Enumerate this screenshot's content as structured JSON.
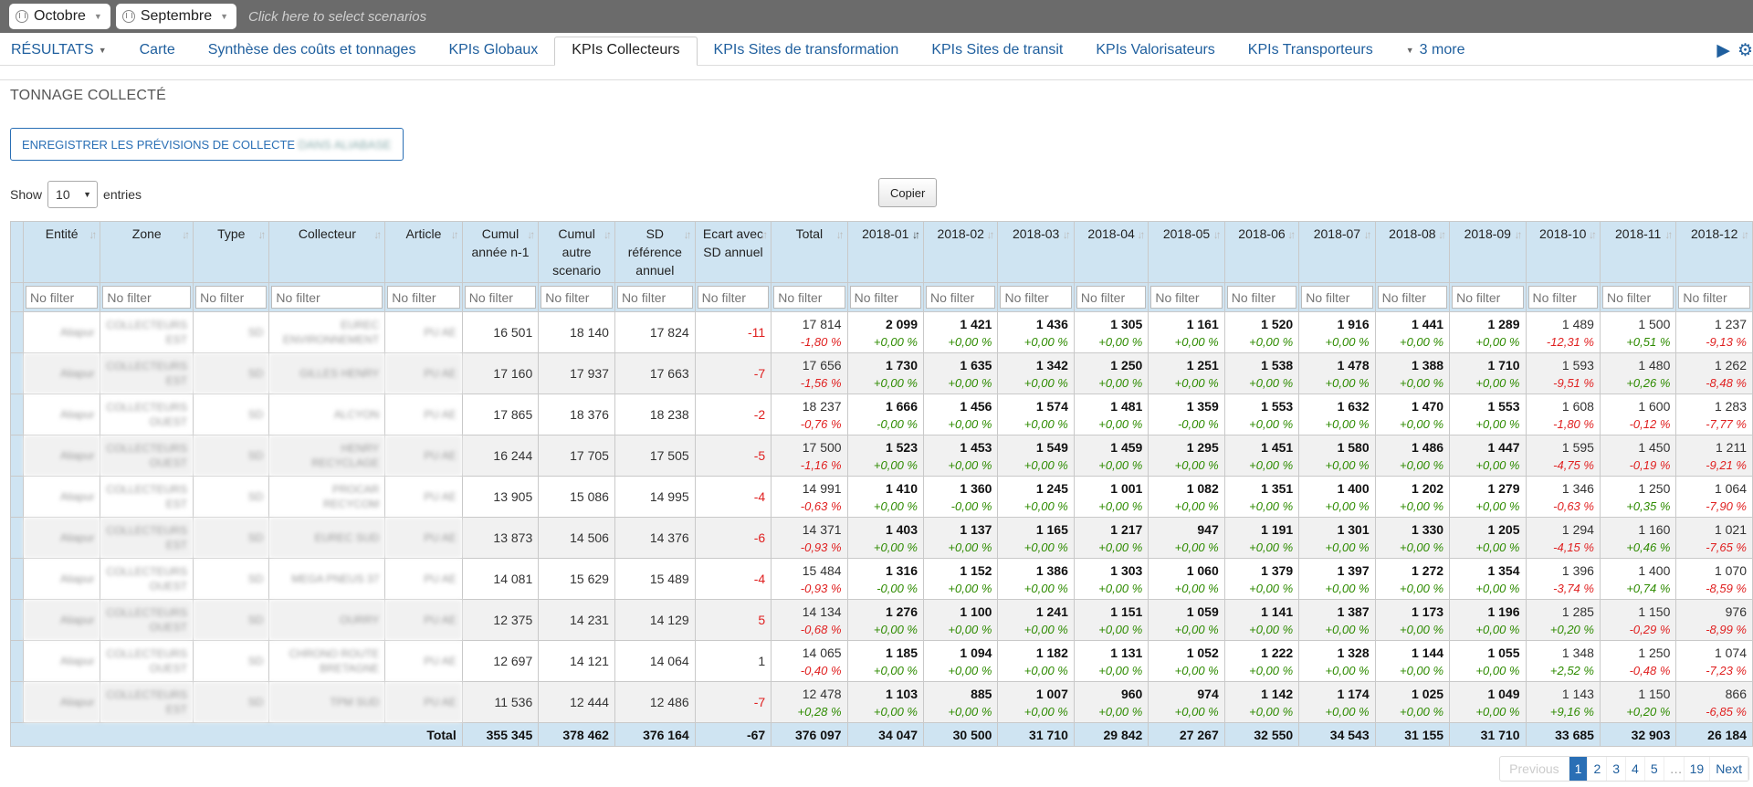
{
  "scenarios": {
    "first": "Octobre",
    "second": "Septembre",
    "placeholder": "Click here to select scenarios"
  },
  "nav": {
    "results": "RÉSULTATS",
    "tabs": [
      "Carte",
      "Synthèse des coûts et tonnages",
      "KPIs Globaux",
      "KPIs Collecteurs",
      "KPIs Sites de transformation",
      "KPIs Sites de transit",
      "KPIs Valorisateurs",
      "KPIs Transporteurs"
    ],
    "active": "KPIs Collecteurs",
    "more": "3 more"
  },
  "section_title": "TONNAGE COLLECTÉ",
  "save_button": {
    "text": "ENREGISTRER LES PRÉVISIONS DE COLLECTE",
    "blurred": "DANS ALIABASE"
  },
  "copy_button": "Copier",
  "length": {
    "show": "Show",
    "value": "10",
    "entries": "entries"
  },
  "filter_placeholder": "No filter",
  "colors": {
    "header_bg": "#cfe4f2",
    "link": "#1f5f9e",
    "positive": "#2e8b00",
    "negative": "#e02020",
    "topbar": "#6b6b6b"
  },
  "table": {
    "headers": [
      "Entité",
      "Zone",
      "Type",
      "Collecteur",
      "Article",
      "Cumul année n-1",
      "Cumul autre scenario",
      "SD référence annuel",
      "Ecart avec SD annuel",
      "Total",
      "2018-01",
      "2018-02",
      "2018-03",
      "2018-04",
      "2018-05",
      "2018-06",
      "2018-07",
      "2018-08",
      "2018-09",
      "2018-10",
      "2018-11",
      "2018-12"
    ],
    "rows": [
      {
        "ent": "Aliapur",
        "zone": "COLLECTEURS EST",
        "type": "SD",
        "coll": "EUREC ENVIRONNEMENT",
        "art": "PU AE",
        "n1": "16 501",
        "autre": "18 140",
        "sd": "17 824",
        "ecart": "-11",
        "total": [
          "17 814",
          "-1,80 %"
        ],
        "m": [
          [
            "2 099",
            "+0,00 %"
          ],
          [
            "1 421",
            "+0,00 %"
          ],
          [
            "1 436",
            "+0,00 %"
          ],
          [
            "1 305",
            "+0,00 %"
          ],
          [
            "1 161",
            "+0,00 %"
          ],
          [
            "1 520",
            "+0,00 %"
          ],
          [
            "1 916",
            "+0,00 %"
          ],
          [
            "1 441",
            "+0,00 %"
          ],
          [
            "1 289",
            "+0,00 %"
          ],
          [
            "1 489",
            "-12,31 %"
          ],
          [
            "1 500",
            "+0,51 %"
          ],
          [
            "1 237",
            "-9,13 %"
          ]
        ]
      },
      {
        "ent": "Aliapur",
        "zone": "COLLECTEURS EST",
        "type": "SD",
        "coll": "GILLES HENRY",
        "art": "PU AE",
        "n1": "17 160",
        "autre": "17 937",
        "sd": "17 663",
        "ecart": "-7",
        "total": [
          "17 656",
          "-1,56 %"
        ],
        "m": [
          [
            "1 730",
            "+0,00 %"
          ],
          [
            "1 635",
            "+0,00 %"
          ],
          [
            "1 342",
            "+0,00 %"
          ],
          [
            "1 250",
            "+0,00 %"
          ],
          [
            "1 251",
            "+0,00 %"
          ],
          [
            "1 538",
            "+0,00 %"
          ],
          [
            "1 478",
            "+0,00 %"
          ],
          [
            "1 388",
            "+0,00 %"
          ],
          [
            "1 710",
            "+0,00 %"
          ],
          [
            "1 593",
            "-9,51 %"
          ],
          [
            "1 480",
            "+0,26 %"
          ],
          [
            "1 262",
            "-8,48 %"
          ]
        ]
      },
      {
        "ent": "Aliapur",
        "zone": "COLLECTEURS OUEST",
        "type": "SD",
        "coll": "ALCYON",
        "art": "PU AE",
        "n1": "17 865",
        "autre": "18 376",
        "sd": "18 238",
        "ecart": "-2",
        "total": [
          "18 237",
          "-0,76 %"
        ],
        "m": [
          [
            "1 666",
            "-0,00 %"
          ],
          [
            "1 456",
            "+0,00 %"
          ],
          [
            "1 574",
            "+0,00 %"
          ],
          [
            "1 481",
            "+0,00 %"
          ],
          [
            "1 359",
            "-0,00 %"
          ],
          [
            "1 553",
            "+0,00 %"
          ],
          [
            "1 632",
            "+0,00 %"
          ],
          [
            "1 470",
            "+0,00 %"
          ],
          [
            "1 553",
            "+0,00 %"
          ],
          [
            "1 608",
            "-1,80 %"
          ],
          [
            "1 600",
            "-0,12 %"
          ],
          [
            "1 283",
            "-7,77 %"
          ]
        ]
      },
      {
        "ent": "Aliapur",
        "zone": "COLLECTEURS OUEST",
        "type": "SD",
        "coll": "HENRY RECYCLAGE",
        "art": "PU AE",
        "n1": "16 244",
        "autre": "17 705",
        "sd": "17 505",
        "ecart": "-5",
        "total": [
          "17 500",
          "-1,16 %"
        ],
        "m": [
          [
            "1 523",
            "+0,00 %"
          ],
          [
            "1 453",
            "+0,00 %"
          ],
          [
            "1 549",
            "+0,00 %"
          ],
          [
            "1 459",
            "+0,00 %"
          ],
          [
            "1 295",
            "+0,00 %"
          ],
          [
            "1 451",
            "+0,00 %"
          ],
          [
            "1 580",
            "+0,00 %"
          ],
          [
            "1 486",
            "+0,00 %"
          ],
          [
            "1 447",
            "+0,00 %"
          ],
          [
            "1 595",
            "-4,75 %"
          ],
          [
            "1 450",
            "-0,19 %"
          ],
          [
            "1 211",
            "-9,21 %"
          ]
        ]
      },
      {
        "ent": "Aliapur",
        "zone": "COLLECTEURS EST",
        "type": "SD",
        "coll": "PROCAR RECYCOM",
        "art": "PU AE",
        "n1": "13 905",
        "autre": "15 086",
        "sd": "14 995",
        "ecart": "-4",
        "total": [
          "14 991",
          "-0,63 %"
        ],
        "m": [
          [
            "1 410",
            "+0,00 %"
          ],
          [
            "1 360",
            "-0,00 %"
          ],
          [
            "1 245",
            "+0,00 %"
          ],
          [
            "1 001",
            "+0,00 %"
          ],
          [
            "1 082",
            "+0,00 %"
          ],
          [
            "1 351",
            "+0,00 %"
          ],
          [
            "1 400",
            "+0,00 %"
          ],
          [
            "1 202",
            "+0,00 %"
          ],
          [
            "1 279",
            "+0,00 %"
          ],
          [
            "1 346",
            "-0,63 %"
          ],
          [
            "1 250",
            "+0,35 %"
          ],
          [
            "1 064",
            "-7,90 %"
          ]
        ]
      },
      {
        "ent": "Aliapur",
        "zone": "COLLECTEURS EST",
        "type": "SD",
        "coll": "EUREC SUD",
        "art": "PU AE",
        "n1": "13 873",
        "autre": "14 506",
        "sd": "14 376",
        "ecart": "-6",
        "total": [
          "14 371",
          "-0,93 %"
        ],
        "m": [
          [
            "1 403",
            "+0,00 %"
          ],
          [
            "1 137",
            "+0,00 %"
          ],
          [
            "1 165",
            "+0,00 %"
          ],
          [
            "1 217",
            "+0,00 %"
          ],
          [
            "947",
            "+0,00 %"
          ],
          [
            "1 191",
            "+0,00 %"
          ],
          [
            "1 301",
            "+0,00 %"
          ],
          [
            "1 330",
            "+0,00 %"
          ],
          [
            "1 205",
            "+0,00 %"
          ],
          [
            "1 294",
            "-4,15 %"
          ],
          [
            "1 160",
            "+0,46 %"
          ],
          [
            "1 021",
            "-7,65 %"
          ]
        ]
      },
      {
        "ent": "Aliapur",
        "zone": "COLLECTEURS OUEST",
        "type": "SD",
        "coll": "MEGA PNEUS 37",
        "art": "PU AE",
        "n1": "14 081",
        "autre": "15 629",
        "sd": "15 489",
        "ecart": "-4",
        "total": [
          "15 484",
          "-0,93 %"
        ],
        "m": [
          [
            "1 316",
            "-0,00 %"
          ],
          [
            "1 152",
            "+0,00 %"
          ],
          [
            "1 386",
            "+0,00 %"
          ],
          [
            "1 303",
            "+0,00 %"
          ],
          [
            "1 060",
            "+0,00 %"
          ],
          [
            "1 379",
            "+0,00 %"
          ],
          [
            "1 397",
            "+0,00 %"
          ],
          [
            "1 272",
            "+0,00 %"
          ],
          [
            "1 354",
            "+0,00 %"
          ],
          [
            "1 396",
            "-3,74 %"
          ],
          [
            "1 400",
            "+0,74 %"
          ],
          [
            "1 070",
            "-8,59 %"
          ]
        ]
      },
      {
        "ent": "Aliapur",
        "zone": "COLLECTEURS OUEST",
        "type": "SD",
        "coll": "OURRY",
        "art": "PU AE",
        "n1": "12 375",
        "autre": "14 231",
        "sd": "14 129",
        "ecart": "5",
        "total": [
          "14 134",
          "-0,68 %"
        ],
        "m": [
          [
            "1 276",
            "+0,00 %"
          ],
          [
            "1 100",
            "+0,00 %"
          ],
          [
            "1 241",
            "+0,00 %"
          ],
          [
            "1 151",
            "+0,00 %"
          ],
          [
            "1 059",
            "+0,00 %"
          ],
          [
            "1 141",
            "+0,00 %"
          ],
          [
            "1 387",
            "+0,00 %"
          ],
          [
            "1 173",
            "+0,00 %"
          ],
          [
            "1 196",
            "+0,00 %"
          ],
          [
            "1 285",
            "+0,20 %"
          ],
          [
            "1 150",
            "-0,29 %"
          ],
          [
            "976",
            "-8,99 %"
          ]
        ]
      },
      {
        "ent": "Aliapur",
        "zone": "COLLECTEURS OUEST",
        "type": "SD",
        "coll": "CHRONO ROUTE BRETAGNE",
        "art": "PU AE",
        "n1": "12 697",
        "autre": "14 121",
        "sd": "14 064",
        "ecart": "1",
        "total": [
          "14 065",
          "-0,40 %"
        ],
        "m": [
          [
            "1 185",
            "+0,00 %"
          ],
          [
            "1 094",
            "+0,00 %"
          ],
          [
            "1 182",
            "+0,00 %"
          ],
          [
            "1 131",
            "+0,00 %"
          ],
          [
            "1 052",
            "+0,00 %"
          ],
          [
            "1 222",
            "+0,00 %"
          ],
          [
            "1 328",
            "+0,00 %"
          ],
          [
            "1 144",
            "+0,00 %"
          ],
          [
            "1 055",
            "+0,00 %"
          ],
          [
            "1 348",
            "+2,52 %"
          ],
          [
            "1 250",
            "-0,48 %"
          ],
          [
            "1 074",
            "-7,23 %"
          ]
        ]
      },
      {
        "ent": "Aliapur",
        "zone": "COLLECTEURS EST",
        "type": "SD",
        "coll": "TPM SUD",
        "art": "PU AE",
        "n1": "11 536",
        "autre": "12 444",
        "sd": "12 486",
        "ecart": "-7",
        "total": [
          "12 478",
          "+0,28 %"
        ],
        "m": [
          [
            "1 103",
            "+0,00 %"
          ],
          [
            "885",
            "+0,00 %"
          ],
          [
            "1 007",
            "+0,00 %"
          ],
          [
            "960",
            "+0,00 %"
          ],
          [
            "974",
            "+0,00 %"
          ],
          [
            "1 142",
            "+0,00 %"
          ],
          [
            "1 174",
            "+0,00 %"
          ],
          [
            "1 025",
            "+0,00 %"
          ],
          [
            "1 049",
            "+0,00 %"
          ],
          [
            "1 143",
            "+9,16 %"
          ],
          [
            "1 150",
            "+0,20 %"
          ],
          [
            "866",
            "-6,85 %"
          ]
        ]
      }
    ],
    "footer": {
      "label": "Total",
      "values": [
        "355 345",
        "378 462",
        "376 164",
        "-67",
        "376 097",
        "34 047",
        "30 500",
        "31 710",
        "29 842",
        "27 267",
        "32 550",
        "34 543",
        "31 155",
        "31 710",
        "33 685",
        "32 903",
        "26 184"
      ]
    }
  },
  "pagination": {
    "previous": "Previous",
    "pages": [
      "1",
      "2",
      "3",
      "4",
      "5"
    ],
    "gap": "…",
    "last": "19",
    "next": "Next",
    "current": "1"
  }
}
